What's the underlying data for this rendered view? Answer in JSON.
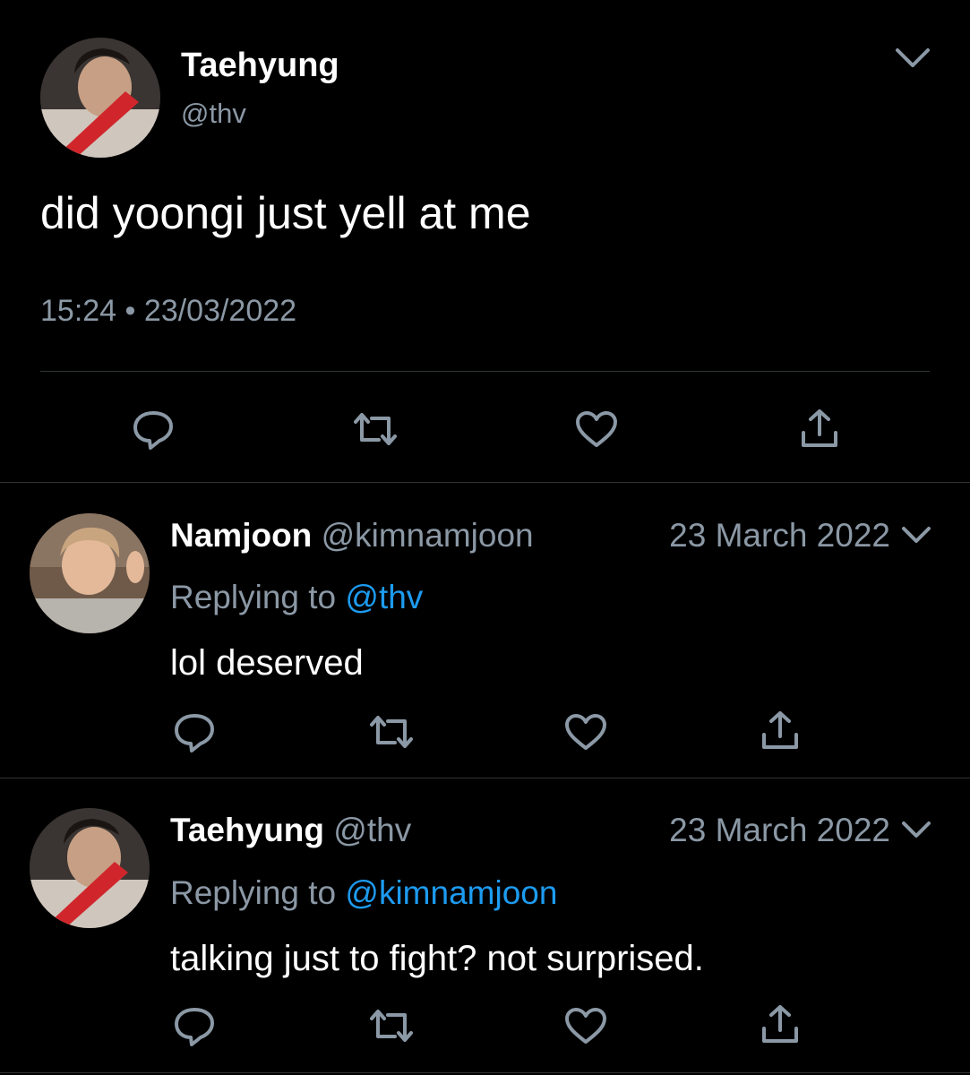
{
  "colors": {
    "background": "#000000",
    "text_primary": "#ffffff",
    "text_secondary": "#8b98a5",
    "link": "#1d9bf0",
    "divider": "#2f3336"
  },
  "main_tweet": {
    "author_name": "Taehyung",
    "author_handle": "@thv",
    "text": "did yoongi just yell at me",
    "time": "15:24",
    "separator": "•",
    "date": "23/03/2022",
    "menu_icon": "chevron-down-icon",
    "actions": [
      "reply-icon",
      "retweet-icon",
      "like-icon",
      "share-icon"
    ]
  },
  "replies": [
    {
      "author_name": "Namjoon",
      "author_handle": "@kimnamjoon",
      "date": "23 March 2022",
      "replying_label": "Replying to",
      "replying_to": "@thv",
      "text": "lol deserved"
    },
    {
      "author_name": "Taehyung",
      "author_handle": "@thv",
      "date": "23 March 2022",
      "replying_label": "Replying to",
      "replying_to": "@kimnamjoon",
      "text": "talking just to fight? not surprised."
    }
  ]
}
